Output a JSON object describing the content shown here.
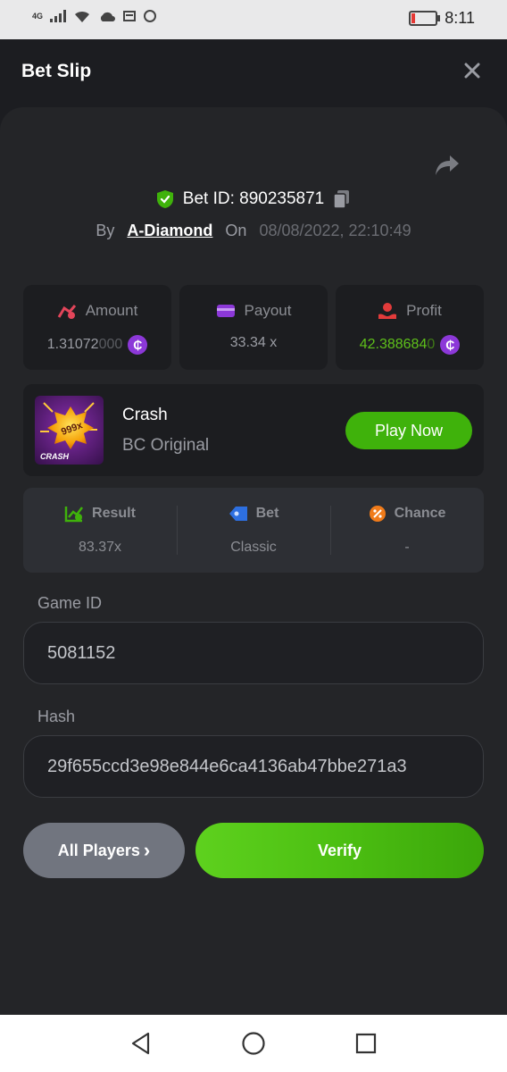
{
  "status": {
    "network": "4G",
    "time": "8:11"
  },
  "header": {
    "title": "Bet Slip"
  },
  "bet": {
    "id_label": "Bet ID: 890235871",
    "by_label": "By",
    "user": "A-Diamond",
    "on_label": "On",
    "datetime": "08/08/2022, 22:10:49"
  },
  "stats": {
    "amount": {
      "label": "Amount",
      "value_main": "1.31072",
      "value_dim": "000"
    },
    "payout": {
      "label": "Payout",
      "value": "33.34 x"
    },
    "profit": {
      "label": "Profit",
      "value_main": "42.388684",
      "value_dim": "0"
    }
  },
  "coin_symbol": "₵",
  "game": {
    "name": "Crash",
    "provider": "BC Original",
    "play_label": "Play Now",
    "thumb_badge": "999x",
    "thumb_caption": "CRASH"
  },
  "details": {
    "result": {
      "label": "Result",
      "value": "83.37x"
    },
    "bet": {
      "label": "Bet",
      "value": "Classic"
    },
    "chance": {
      "label": "Chance",
      "value": "-"
    }
  },
  "fields": {
    "game_id": {
      "label": "Game ID",
      "value": "5081152"
    },
    "hash": {
      "label": "Hash",
      "value": "29f655ccd3e98e844e6ca4136ab47bbe271a3"
    }
  },
  "actions": {
    "players_label": "All Players",
    "players_arrow": "›",
    "verify_label": "Verify"
  },
  "colors": {
    "accent_green": "#3fb20b",
    "coin_purple": "#8c38d8",
    "profit_green": "#5ec01a"
  }
}
